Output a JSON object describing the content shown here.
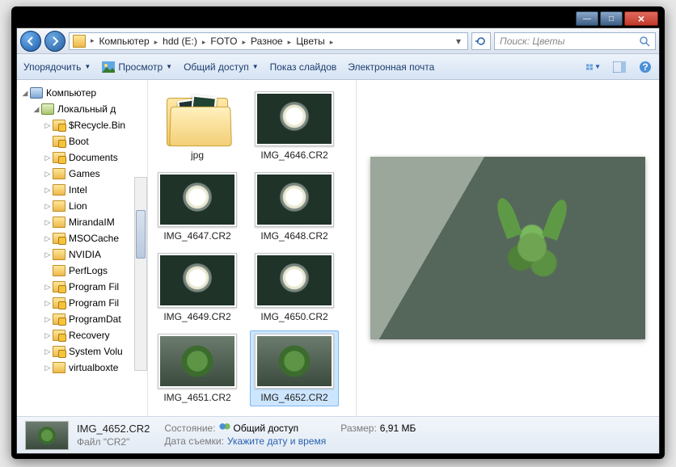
{
  "titlebar": {
    "min": "—",
    "max": "□",
    "close": "×"
  },
  "breadcrumb": [
    "Компьютер",
    "hdd (E:)",
    "FOTO",
    "Разное",
    "Цветы"
  ],
  "search": {
    "placeholder": "Поиск: Цветы"
  },
  "toolbar": {
    "organize": "Упорядочить",
    "preview": "Просмотр",
    "share": "Общий доступ",
    "slideshow": "Показ слайдов",
    "email": "Электронная почта"
  },
  "tree": [
    {
      "indent": 0,
      "tw": "◢",
      "icon": "comp",
      "label": "Компьютер"
    },
    {
      "indent": 1,
      "tw": "◢",
      "icon": "drive",
      "label": "Локальный д"
    },
    {
      "indent": 2,
      "tw": "▷",
      "icon": "lock",
      "label": "$Recycle.Bin"
    },
    {
      "indent": 2,
      "tw": "",
      "icon": "lock",
      "label": "Boot"
    },
    {
      "indent": 2,
      "tw": "▷",
      "icon": "lock",
      "label": "Documents"
    },
    {
      "indent": 2,
      "tw": "▷",
      "icon": "fold",
      "label": "Games"
    },
    {
      "indent": 2,
      "tw": "▷",
      "icon": "fold",
      "label": "Intel"
    },
    {
      "indent": 2,
      "tw": "▷",
      "icon": "fold",
      "label": "Lion"
    },
    {
      "indent": 2,
      "tw": "▷",
      "icon": "fold",
      "label": "MirandaIM"
    },
    {
      "indent": 2,
      "tw": "▷",
      "icon": "lock",
      "label": "MSOCache"
    },
    {
      "indent": 2,
      "tw": "▷",
      "icon": "fold",
      "label": "NVIDIA"
    },
    {
      "indent": 2,
      "tw": "",
      "icon": "fold",
      "label": "PerfLogs"
    },
    {
      "indent": 2,
      "tw": "▷",
      "icon": "lock",
      "label": "Program Fil"
    },
    {
      "indent": 2,
      "tw": "▷",
      "icon": "lock",
      "label": "Program Fil"
    },
    {
      "indent": 2,
      "tw": "▷",
      "icon": "lock",
      "label": "ProgramDat"
    },
    {
      "indent": 2,
      "tw": "▷",
      "icon": "lock",
      "label": "Recovery"
    },
    {
      "indent": 2,
      "tw": "▷",
      "icon": "lock",
      "label": "System Volu"
    },
    {
      "indent": 2,
      "tw": "▷",
      "icon": "fold",
      "label": "virtualboxte"
    }
  ],
  "files": [
    {
      "name": "jpg",
      "kind": "folder",
      "selected": false
    },
    {
      "name": "IMG_4646.CR2",
      "kind": "flower",
      "selected": false
    },
    {
      "name": "IMG_4647.CR2",
      "kind": "flower",
      "selected": false
    },
    {
      "name": "IMG_4648.CR2",
      "kind": "flower",
      "selected": false
    },
    {
      "name": "IMG_4649.CR2",
      "kind": "flower",
      "selected": false
    },
    {
      "name": "IMG_4650.CR2",
      "kind": "flower",
      "selected": false
    },
    {
      "name": "IMG_4651.CR2",
      "kind": "plant",
      "selected": false
    },
    {
      "name": "IMG_4652.CR2",
      "kind": "plant",
      "selected": true
    }
  ],
  "status": {
    "filename": "IMG_4652.CR2",
    "filetype": "Файл \"CR2\"",
    "state_label": "Состояние:",
    "state_value": "Общий доступ",
    "date_label": "Дата съемки:",
    "date_value": "Укажите дату и время",
    "size_label": "Размер:",
    "size_value": "6,91 МБ"
  }
}
